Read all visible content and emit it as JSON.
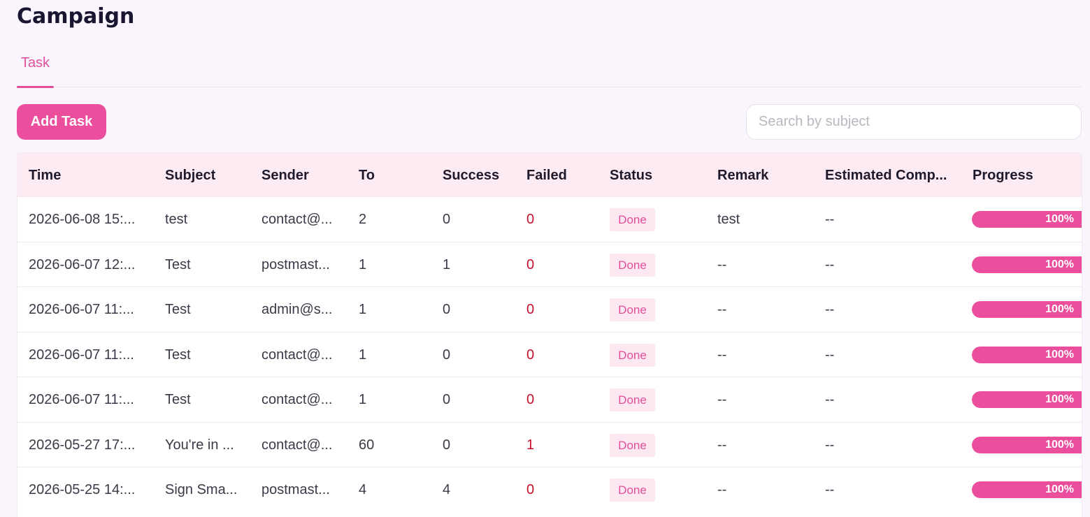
{
  "page": {
    "title": "Campaign"
  },
  "tabs": [
    {
      "label": "Task",
      "active": true
    }
  ],
  "toolbar": {
    "add_label": "Add Task",
    "search_placeholder": "Search by subject",
    "search_value": ""
  },
  "colors": {
    "accent": "#ea4e9c",
    "failed": "#c8102e",
    "badge_bg": "#fde7f1"
  },
  "table": {
    "columns": [
      "Time",
      "Subject",
      "Sender",
      "To",
      "Success",
      "Failed",
      "Status",
      "Remark",
      "Estimated Comp...",
      "Progress"
    ],
    "rows": [
      {
        "time": "2026-06-08 15:...",
        "subject": "test",
        "sender": "contact@...",
        "to": "2",
        "success": "0",
        "failed": "0",
        "status": "Done",
        "remark": "test",
        "estimated": "--",
        "progress_label": "100%",
        "progress": 100
      },
      {
        "time": "2026-06-07 12:...",
        "subject": "Test",
        "sender": "postmast...",
        "to": "1",
        "success": "1",
        "failed": "0",
        "status": "Done",
        "remark": "--",
        "estimated": "--",
        "progress_label": "100%",
        "progress": 100
      },
      {
        "time": "2026-06-07 11:...",
        "subject": "Test",
        "sender": "admin@s...",
        "to": "1",
        "success": "0",
        "failed": "0",
        "status": "Done",
        "remark": "--",
        "estimated": "--",
        "progress_label": "100%",
        "progress": 100
      },
      {
        "time": "2026-06-07 11:...",
        "subject": "Test",
        "sender": "contact@...",
        "to": "1",
        "success": "0",
        "failed": "0",
        "status": "Done",
        "remark": "--",
        "estimated": "--",
        "progress_label": "100%",
        "progress": 100
      },
      {
        "time": "2026-06-07 11:...",
        "subject": "Test",
        "sender": "contact@...",
        "to": "1",
        "success": "0",
        "failed": "0",
        "status": "Done",
        "remark": "--",
        "estimated": "--",
        "progress_label": "100%",
        "progress": 100
      },
      {
        "time": "2026-05-27 17:...",
        "subject": "You're in ...",
        "sender": "contact@...",
        "to": "60",
        "success": "0",
        "failed": "1",
        "status": "Done",
        "remark": "--",
        "estimated": "--",
        "progress_label": "100%",
        "progress": 100
      },
      {
        "time": "2026-05-25 14:...",
        "subject": "Sign Sma...",
        "sender": "postmast...",
        "to": "4",
        "success": "4",
        "failed": "0",
        "status": "Done",
        "remark": "--",
        "estimated": "--",
        "progress_label": "100%",
        "progress": 100
      }
    ]
  }
}
